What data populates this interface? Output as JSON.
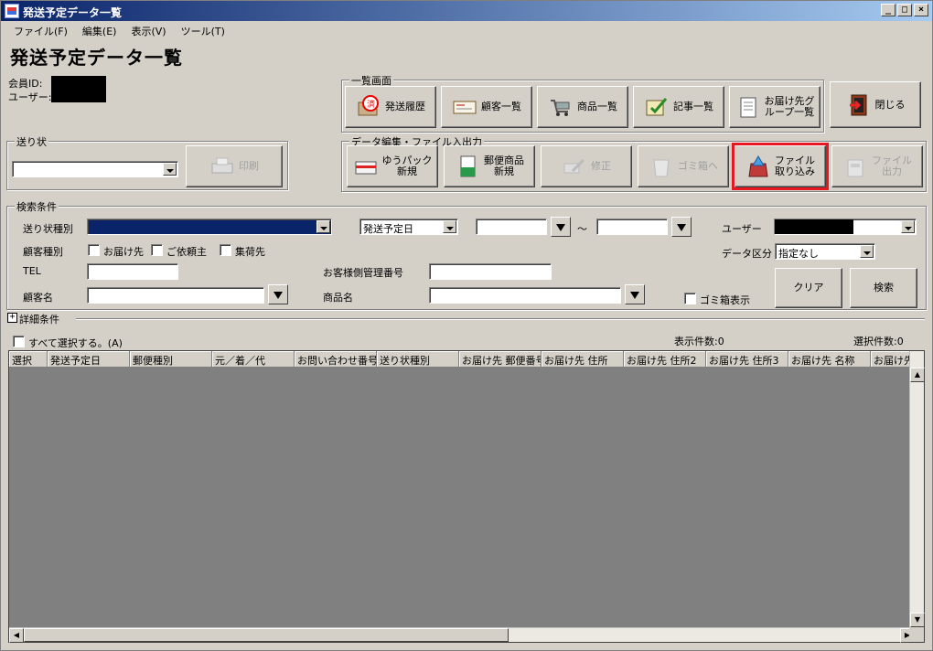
{
  "window": {
    "title": "発送予定データ一覧",
    "min": "_",
    "max": "□",
    "close": "×"
  },
  "menu": [
    "ファイル(F)",
    "編集(E)",
    "表示(V)",
    "ツール(T)"
  ],
  "page_title": "発送予定データ一覧",
  "member": {
    "id_label": "会員ID:",
    "user_label": "ユーザー:"
  },
  "groups": {
    "list": "一覧画面",
    "invoice": "送り状",
    "data_edit": "データ編集・ファイル入出力",
    "search": "検索条件"
  },
  "list_buttons": {
    "history": "発送履歴",
    "customers": "顧客一覧",
    "products": "商品一覧",
    "articles": "記事一覧",
    "dest_group_1": "お届け先グ",
    "dest_group_2": "ループ一覧",
    "close": "閉じる"
  },
  "invoice": {
    "print": "印刷"
  },
  "data_buttons": {
    "yupack_1": "ゆうパック",
    "yupack_2": "新規",
    "postal_1": "郵便商品",
    "postal_2": "新規",
    "edit": "修正",
    "trash": "ゴミ箱へ",
    "file_import_1": "ファイル",
    "file_import_2": "取り込み",
    "file_export_1": "ファイル",
    "file_export_2": "出力"
  },
  "search": {
    "invoice_type_label": "送り状種別",
    "date_type": "発送予定日",
    "tilde": "～",
    "user_label": "ユーザー",
    "customer_type_label": "顧客種別",
    "cb_destination": "お届け先",
    "cb_requester": "ご依頼主",
    "cb_pickup": "集荷先",
    "data_class_label": "データ区分",
    "data_class_value": "指定なし",
    "tel_label": "TEL",
    "mgmt_no_label": "お客様側管理番号",
    "customer_name_label": "顧客名",
    "product_name_label": "商品名",
    "trash_show": "ゴミ箱表示",
    "clear": "クリア",
    "search": "検索"
  },
  "details": {
    "label": "詳細条件"
  },
  "grid": {
    "select_all": "すべて選択する。(A)",
    "display_count": "表示件数:0",
    "selected_count": "選択件数:0",
    "columns": [
      "選択",
      "発送予定日",
      "郵便種別",
      "元／着／代",
      "お問い合わせ番号",
      "送り状種別",
      "お届け先 郵便番号",
      "お届け先 住所",
      "お届け先 住所2",
      "お届け先 住所3",
      "お届け先 名称",
      "お届け先"
    ]
  },
  "colors": {
    "highlight": "#e8161e",
    "selected_field": "#0a246a",
    "grid_bg": "#808080"
  }
}
